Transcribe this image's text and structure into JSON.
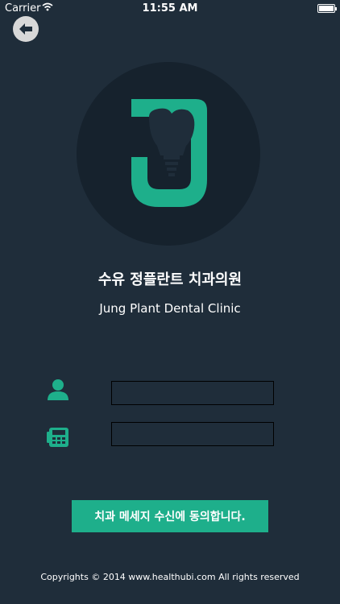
{
  "status_bar": {
    "carrier": "Carrier",
    "time": "11:55 AM",
    "battery_level_pct": 100
  },
  "back_button": {
    "icon": "arrow-left-icon"
  },
  "logo": {
    "icon": "tooth-implant-logo",
    "color": "#1eaf8b"
  },
  "clinic": {
    "name_ko": "수유 정플란트 치과의원",
    "name_en": "Jung Plant Dental Clinic"
  },
  "form": {
    "name_field": {
      "icon": "person-icon",
      "value": "",
      "placeholder": ""
    },
    "phone_field": {
      "icon": "phone-icon",
      "value": "",
      "placeholder": ""
    }
  },
  "consent_button": {
    "label": "치과 메세지 수신에 동의합니다.",
    "color": "#1eaf8b"
  },
  "footer": {
    "text": "Copyrights © 2014 www.healthubi.com All rights reserved"
  },
  "colors": {
    "background": "#1f2d3a",
    "circle": "#16222d",
    "accent": "#1eaf8b"
  }
}
